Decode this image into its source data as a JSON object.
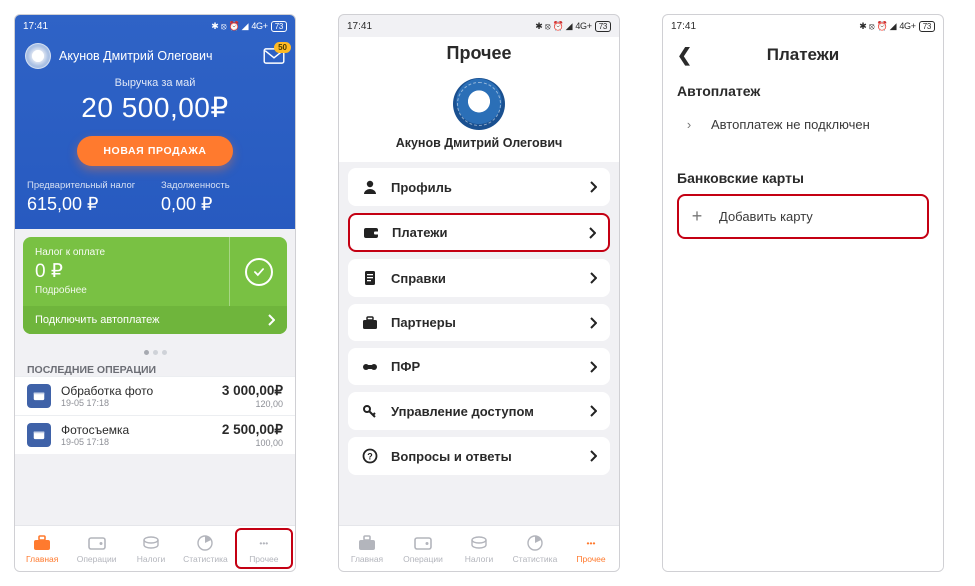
{
  "status": {
    "time": "17:41",
    "icons": "✱ ⦻ ⏰ ◢",
    "net": "4G+",
    "batt": "73"
  },
  "s1": {
    "user": "Акунов Дмитрий Олегович",
    "mail_badge": "50",
    "rev_label": "Выручка за май",
    "rev_amount": "20 500,00₽",
    "new_sale": "НОВАЯ ПРОДАЖА",
    "pre_tax_label": "Предварительный налог",
    "pre_tax": "615,00 ₽",
    "debt_label": "Задолженность",
    "debt": "0,00 ₽",
    "pay_label": "Налог к оплате",
    "pay_amount": "0 ₽",
    "pay_more": "Подробнее",
    "autopay": "Подключить автоплатеж",
    "recent_title": "ПОСЛЕДНИЕ ОПЕРАЦИИ",
    "ops": [
      {
        "name": "Обработка фото",
        "date": "19-05 17:18",
        "amt": "3 000,00₽",
        "sub": "120,00"
      },
      {
        "name": "Фотосъемка",
        "date": "19-05 17:18",
        "amt": "2 500,00₽",
        "sub": "100,00"
      }
    ]
  },
  "tabs": {
    "home": "Главная",
    "ops": "Операции",
    "tax": "Налоги",
    "stat": "Статистика",
    "more": "Прочее"
  },
  "s2": {
    "title": "Прочее",
    "user": "Акунов Дмитрий Олегович",
    "menu": [
      {
        "label": "Профиль"
      },
      {
        "label": "Платежи"
      },
      {
        "label": "Справки"
      },
      {
        "label": "Партнеры"
      },
      {
        "label": "ПФР"
      },
      {
        "label": "Управление доступом"
      },
      {
        "label": "Вопросы и ответы"
      }
    ]
  },
  "s3": {
    "title": "Платежи",
    "sec1": "Автоплатеж",
    "row1": "Автоплатеж не подключен",
    "sec2": "Банковские карты",
    "row2": "Добавить карту"
  }
}
